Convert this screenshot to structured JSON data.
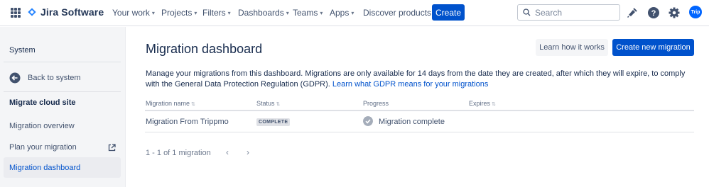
{
  "topnav": {
    "product": "Jira Software",
    "items": [
      {
        "label": "Your work",
        "has_chevron": true
      },
      {
        "label": "Projects",
        "has_chevron": true
      },
      {
        "label": "Filters",
        "has_chevron": true
      },
      {
        "label": "Dashboards",
        "has_chevron": true
      },
      {
        "label": "Teams",
        "has_chevron": true
      },
      {
        "label": "Apps",
        "has_chevron": true
      },
      {
        "label": "Discover products",
        "has_chevron": false
      }
    ],
    "create_label": "Create",
    "search_placeholder": "Search",
    "avatar_initials": "Trip",
    "icons": [
      "notifications-icon",
      "help-icon",
      "settings-icon"
    ]
  },
  "sidebar": {
    "heading": "System",
    "back_label": "Back to system",
    "section": "Migrate cloud site",
    "items": [
      {
        "label": "Migration overview"
      },
      {
        "label": "Plan your migration",
        "external": true
      },
      {
        "label": "Migration dashboard",
        "active": true
      }
    ]
  },
  "main": {
    "title": "Migration dashboard",
    "learn_button": "Learn how it works",
    "create_button": "Create new migration",
    "description": "Manage your migrations from this dashboard. Migrations are only available for 14 days from the date they are created, after which they will expire, to comply with the General Data Protection Regulation (GDPR).",
    "description_link": "Learn what GDPR means for your migrations",
    "columns": [
      "Migration name",
      "Status",
      "Progress",
      "Expires"
    ],
    "rows": [
      {
        "name": "Migration From Trippmo",
        "status": "COMPLETE",
        "progress": "Migration complete",
        "expires": ""
      }
    ],
    "pagination": "1 - 1 of 1 migration"
  },
  "colors": {
    "brand": "#0052CC",
    "sidebar_bg": "#F4F5F7",
    "text": "#172B4D"
  }
}
